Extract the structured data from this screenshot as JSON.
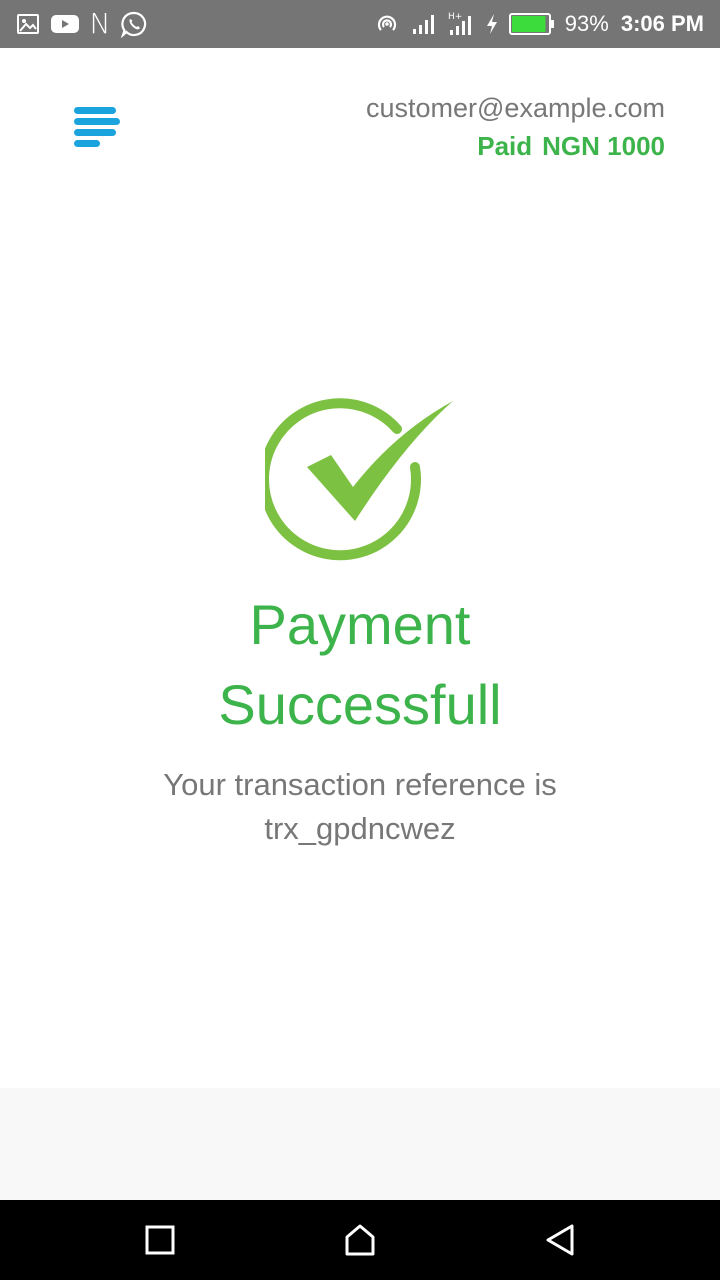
{
  "status_bar": {
    "left_icons": [
      "gallery-icon",
      "youtube-icon",
      "n-icon",
      "whatsapp-icon"
    ],
    "n_glyph": "N",
    "right_icons": [
      "hotspot-icon",
      "signal-icon",
      "signal-h-plus-icon",
      "charging-icon",
      "battery-icon"
    ],
    "battery_percent_text": "93%",
    "battery_level": 0.93,
    "time": "3:06 PM"
  },
  "header": {
    "menu_icon": "menu-icon",
    "email": "customer@example.com",
    "paid_label": "Paid",
    "amount": "NGN 1000"
  },
  "main": {
    "icon": "check-circle-icon",
    "title_line1": "Payment",
    "title_line2": "Successfull",
    "reference_label": "Your transaction reference is",
    "reference_value": "trx_gpdncwez"
  },
  "colors": {
    "accent_green": "#3cb44b",
    "check_green": "#7dc142",
    "menu_blue": "#1aa3dc",
    "status_bar": "#757575",
    "text_gray": "#777777"
  },
  "nav_bar": {
    "buttons": [
      "recents-icon",
      "home-icon",
      "back-icon"
    ]
  }
}
